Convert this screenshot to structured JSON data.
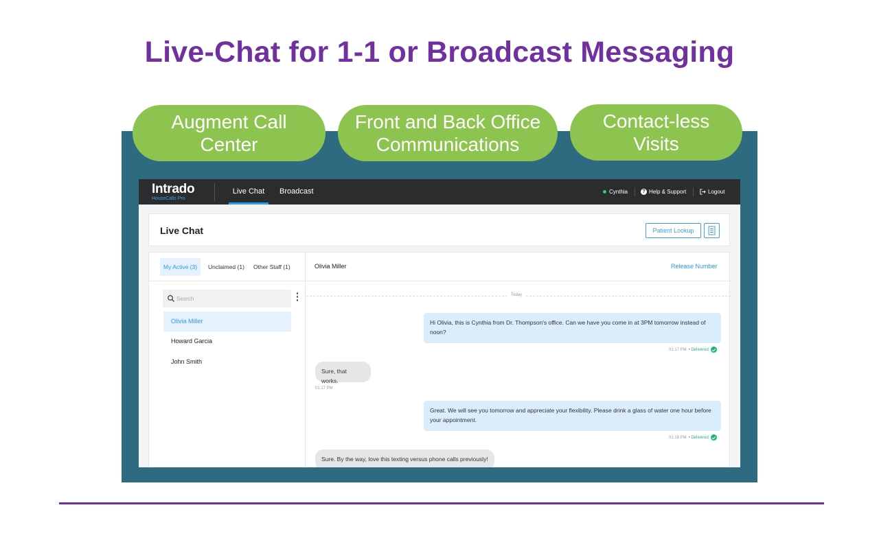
{
  "slide": {
    "title": "Live-Chat for 1-1 or Broadcast Messaging",
    "features": [
      "Augment Call\nCenter",
      "Front and Back Office\nCommunications",
      "Contact-less\nVisits"
    ]
  },
  "app": {
    "logo": {
      "name": "Intrado",
      "subtitle": "HouseCalls Pro"
    },
    "nav": {
      "live_chat": "Live Chat",
      "broadcast": "Broadcast"
    },
    "topbar": {
      "user": "Cynthia",
      "help": "Help & Support",
      "logout": "Logout"
    },
    "header": {
      "title": "Live Chat",
      "patient_lookup": "Patient Lookup"
    },
    "tabs": [
      "My Active (3)",
      "Unclaimed (1)",
      "Other Staff (1)"
    ],
    "search": {
      "placeholder": "Search"
    },
    "contacts": [
      "Olivia Miller",
      "Howard Garcia",
      "John Smith"
    ],
    "chat": {
      "recipient": "Olivia Miller",
      "release": "Release Number",
      "date_divider": "Today",
      "messages": [
        {
          "direction": "out",
          "text": "Hi Olivia, this is Cynthia from Dr. Thompson's office. Can we have you come in at 3PM tomorrow instead of noon?",
          "time": "01:17 PM",
          "status": "Delivered"
        },
        {
          "direction": "in",
          "text": "Sure, that works.",
          "time": "01:17 PM"
        },
        {
          "direction": "out",
          "text": "Great. We will see you tomorrow and appreciate your flexibility. Please drink a glass of water one hour before your appointment.",
          "time": "01:18 PM",
          "status": "Delivered"
        },
        {
          "direction": "in",
          "text": "Sure. By the way, love this texting versus phone calls previously!"
        }
      ]
    }
  },
  "colors": {
    "title": "#7030a0",
    "pill": "#8cc44f",
    "frame": "#2e6a80",
    "accent": "#2d9ae8",
    "delivered": "#1db37a"
  }
}
